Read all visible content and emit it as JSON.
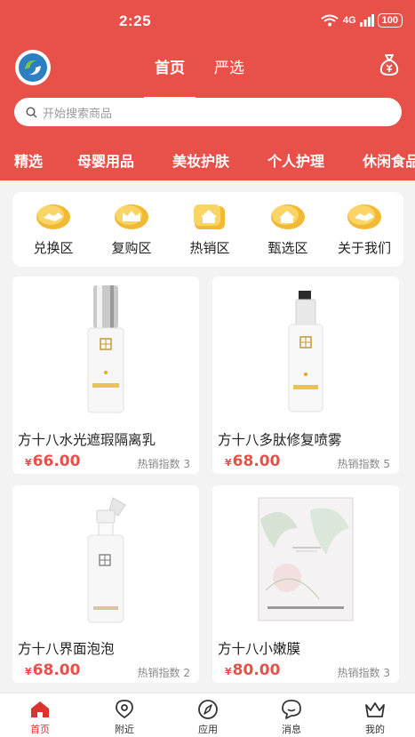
{
  "status": {
    "time": "2:25",
    "network": "4G",
    "battery": "100"
  },
  "header": {
    "tabs": [
      "首页",
      "严选"
    ]
  },
  "search": {
    "placeholder": "开始搜索商品"
  },
  "categories": [
    "精选",
    "母婴用品",
    "美妆护肤",
    "个人护理",
    "休闲食品"
  ],
  "quick_entries": [
    {
      "label": "兑换区",
      "icon": "handshake-icon"
    },
    {
      "label": "复购区",
      "icon": "crown-icon"
    },
    {
      "label": "热销区",
      "icon": "house-icon"
    },
    {
      "label": "甄选区",
      "icon": "house-icon"
    },
    {
      "label": "关于我们",
      "icon": "handshake-icon"
    }
  ],
  "products": [
    {
      "name": "方十八水光遮瑕隔离乳",
      "price": "66.00",
      "currency": "¥",
      "hot": "热销指数 3"
    },
    {
      "name": "方十八多肽修复喷雾",
      "price": "68.00",
      "currency": "¥",
      "hot": "热销指数 5"
    },
    {
      "name": "方十八界面泡泡",
      "price": "68.00",
      "currency": "¥",
      "hot": "热销指数 2"
    },
    {
      "name": "方十八小嫩膜",
      "price": "80.00",
      "currency": "¥",
      "hot": "热销指数 3"
    }
  ],
  "tabbar": [
    "首页",
    "附近",
    "应用",
    "消息",
    "我的"
  ],
  "colors": {
    "primary": "#e8504a",
    "accent_gold": "#f2b935"
  }
}
